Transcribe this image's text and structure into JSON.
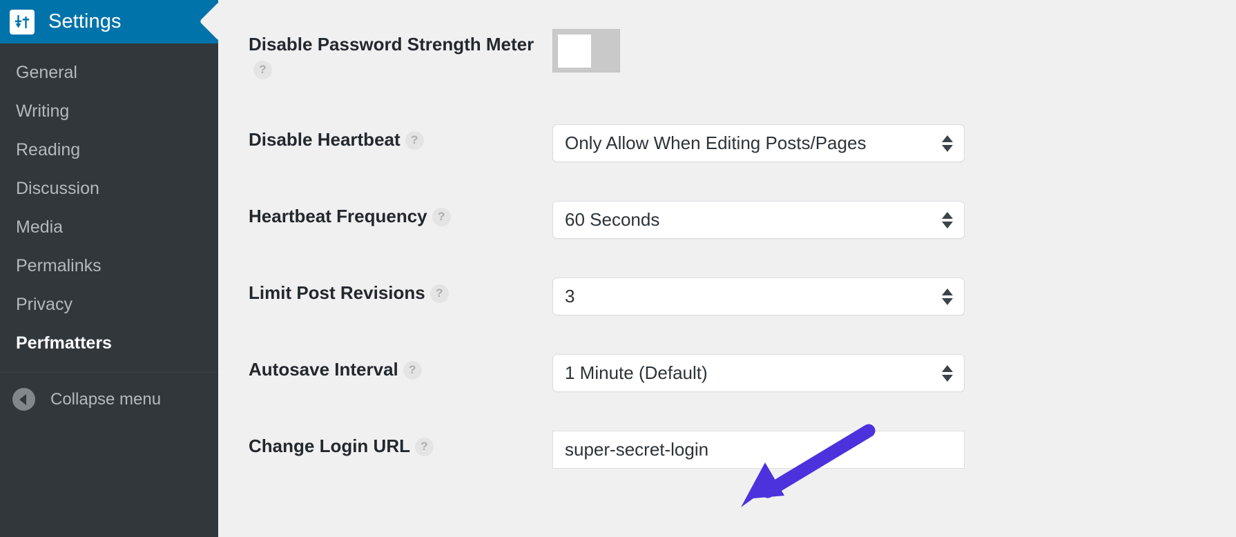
{
  "sidebar": {
    "header": {
      "title": "Settings",
      "icon": "settings-sliders-icon"
    },
    "items": [
      {
        "label": "General",
        "active": false
      },
      {
        "label": "Writing",
        "active": false
      },
      {
        "label": "Reading",
        "active": false
      },
      {
        "label": "Discussion",
        "active": false
      },
      {
        "label": "Media",
        "active": false
      },
      {
        "label": "Permalinks",
        "active": false
      },
      {
        "label": "Privacy",
        "active": false
      },
      {
        "label": "Perfmatters",
        "active": true
      }
    ],
    "collapse": {
      "label": "Collapse menu",
      "icon": "chevron-left-icon"
    }
  },
  "main": {
    "help_glyph": "?",
    "fields": [
      {
        "label": "Disable Password Strength Meter",
        "type": "toggle",
        "value": "off"
      },
      {
        "label": "Disable Heartbeat",
        "type": "select",
        "value": "Only Allow When Editing Posts/Pages"
      },
      {
        "label": "Heartbeat Frequency",
        "type": "select",
        "value": "60 Seconds"
      },
      {
        "label": "Limit Post Revisions",
        "type": "select",
        "value": "3"
      },
      {
        "label": "Autosave Interval",
        "type": "select",
        "value": "1 Minute (Default)"
      },
      {
        "label": "Change Login URL",
        "type": "text",
        "value": "super-secret-login"
      }
    ]
  },
  "annotation": {
    "type": "arrow",
    "color": "#4B32DC",
    "points_to": "change-login-url-input"
  },
  "colors": {
    "sidebar_bg": "#32373c",
    "header_blue": "#0073aa",
    "content_bg": "#f0f0f1",
    "text_dark": "#23282d",
    "menu_text": "#b4b9be",
    "annotation_purple": "#4B32DC"
  }
}
